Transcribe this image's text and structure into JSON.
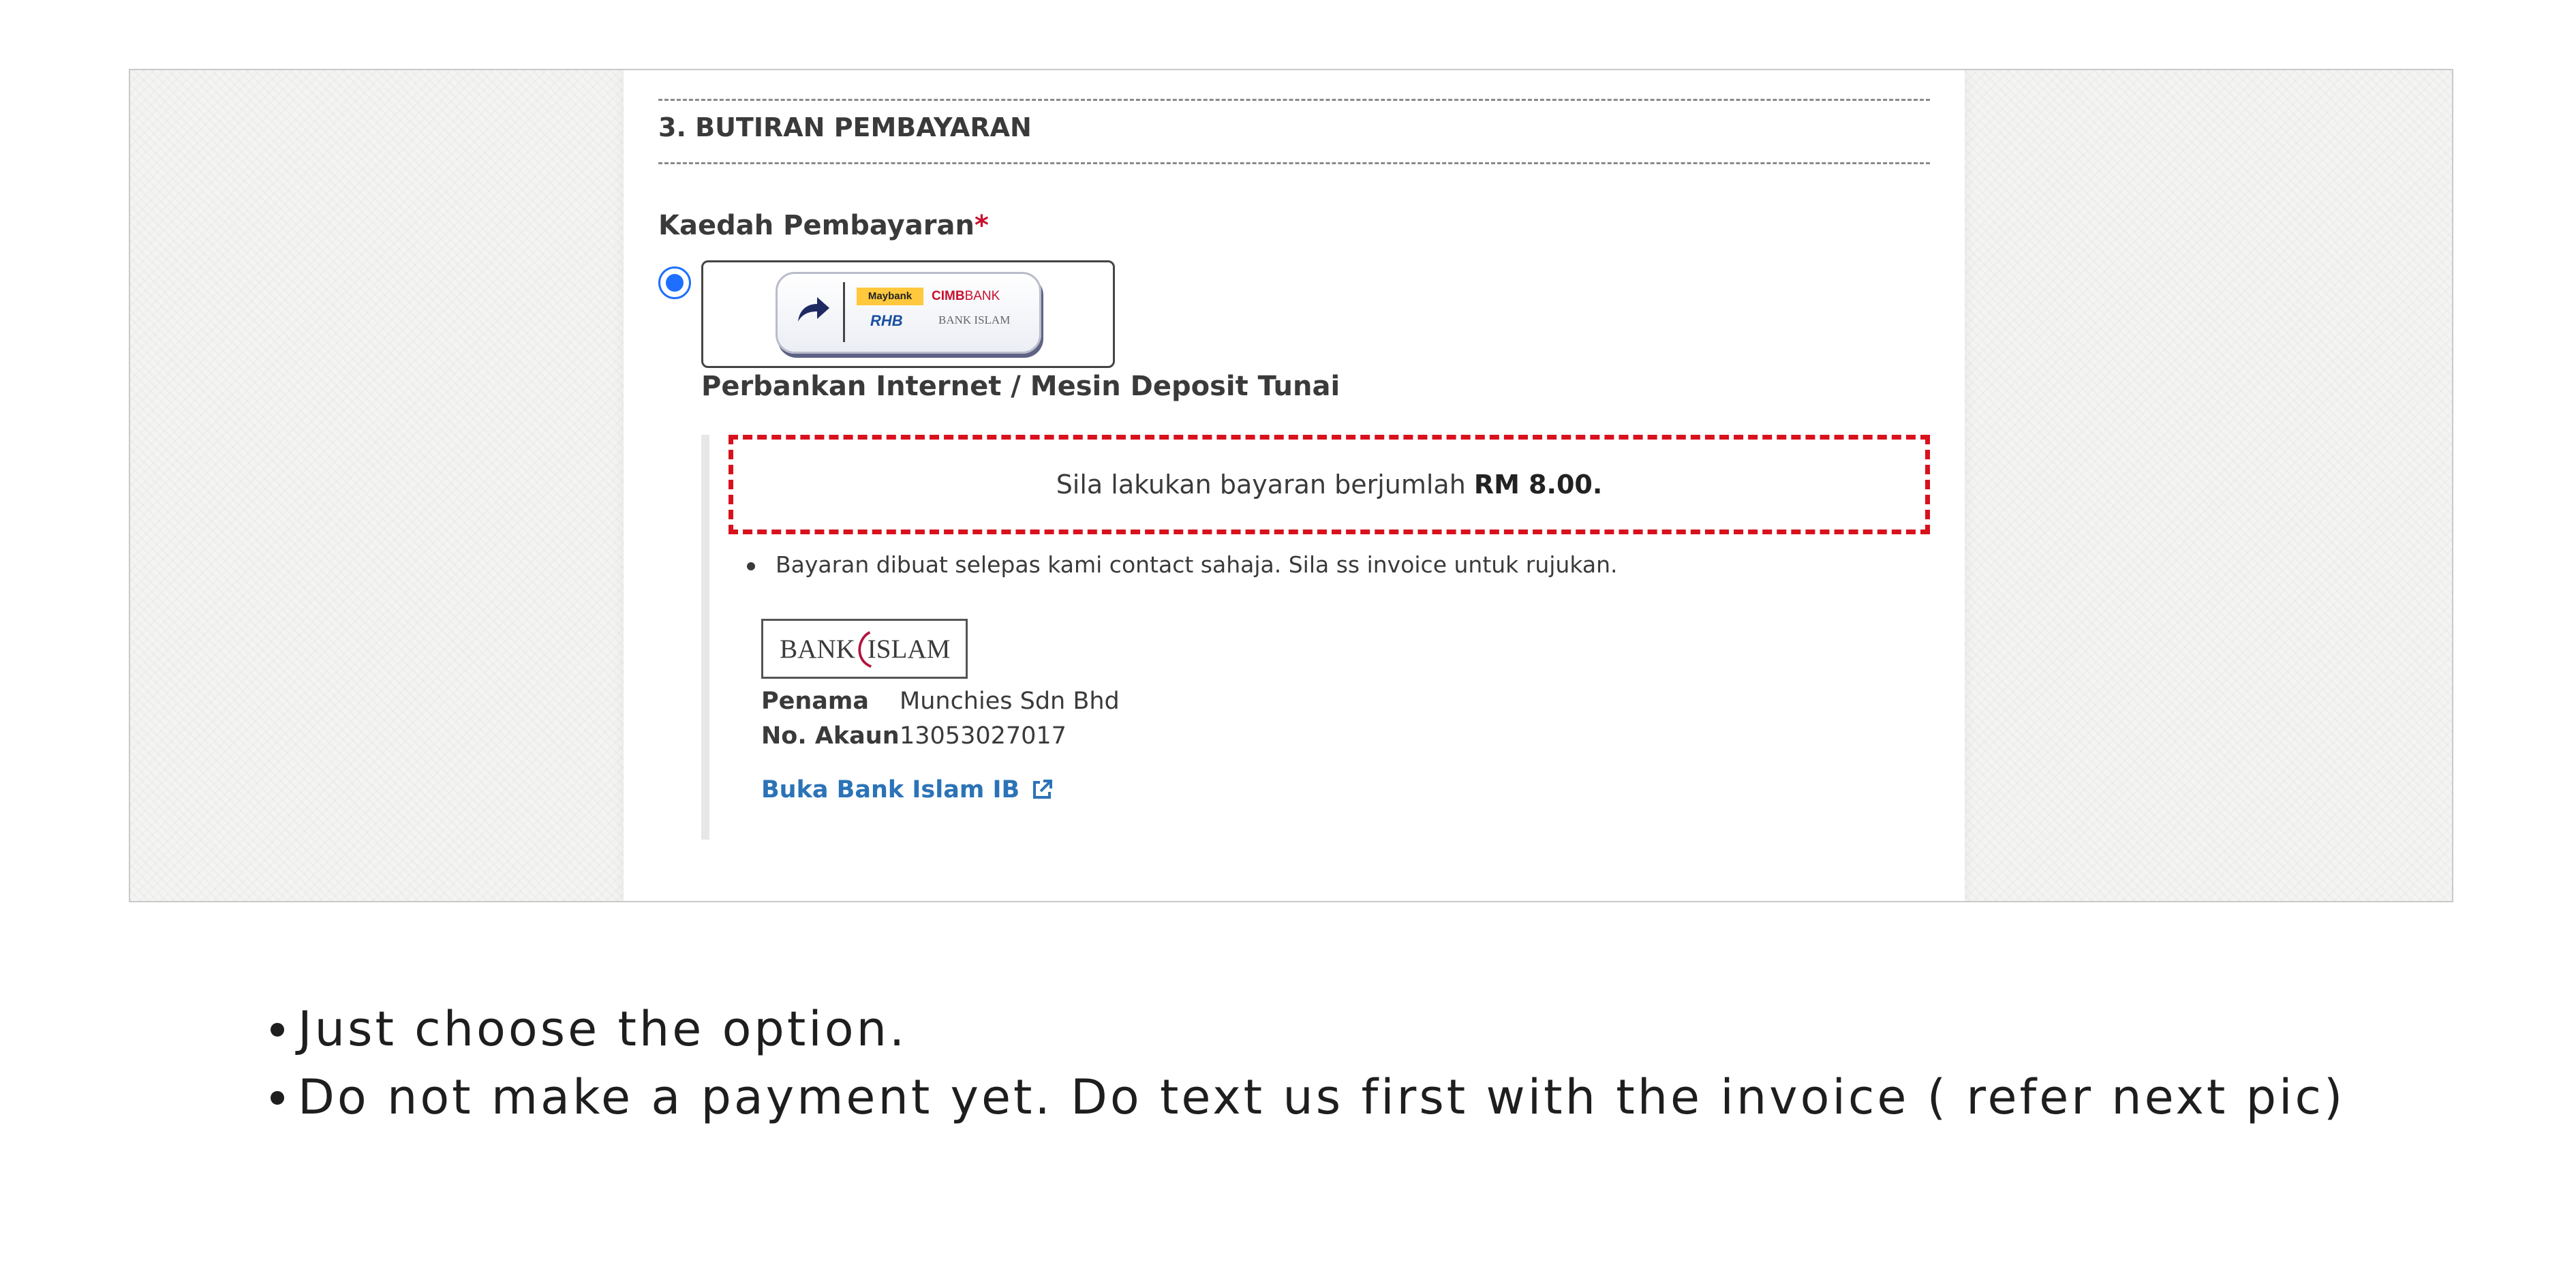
{
  "section": {
    "title": "3. BUTIRAN PEMBAYARAN"
  },
  "payment": {
    "label": "Kaedah Pembayaran",
    "required_mark": "*",
    "option": {
      "label": "Perbankan Internet / Mesin Deposit Tunai",
      "selected": true,
      "banks": {
        "maybank": "Maybank",
        "cimb_bold": "CIMB",
        "cimb_light": "BANK",
        "rhb": "RHB",
        "bank_islam": "BANK ISLAM"
      }
    },
    "notice": {
      "text": "Sila lakukan bayaran berjumlah",
      "amount": "RM 8.00."
    },
    "note": "Bayaran dibuat selepas kami contact sahaja. Sila ss invoice untuk rujukan.",
    "bank": {
      "logo_left": "BANK",
      "logo_right": "ISLAM",
      "payee_key": "Penama",
      "payee_value": "Munchies Sdn Bhd",
      "account_key": "No. Akaun",
      "account_value": "13053027017",
      "open_link": "Buka Bank Islam IB"
    }
  },
  "instructions": [
    "Just choose the option.",
    "Do not make a payment yet. Do text us first with the invoice ( refer next pic)"
  ],
  "colors": {
    "accent_blue": "#1e6fff",
    "link_blue": "#2b73b7",
    "notice_red": "#d9101d",
    "required_red": "#c8102e"
  },
  "icons": {
    "radio": "radio-selected-icon",
    "share": "share-arrow-icon",
    "external": "external-link-icon"
  }
}
